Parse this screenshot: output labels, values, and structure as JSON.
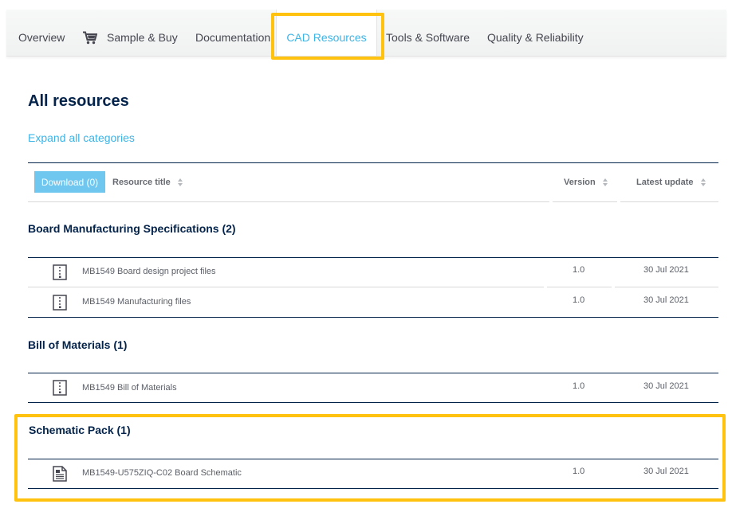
{
  "tabs": {
    "overview": "Overview",
    "sample_buy": "Sample & Buy",
    "documentation": "Documentation",
    "cad_resources": "CAD Resources",
    "tools_software": "Tools & Software",
    "quality_reliability": "Quality & Reliability",
    "active": "CAD Resources"
  },
  "page": {
    "title": "All resources",
    "expand_link": "Expand all categories"
  },
  "table_header": {
    "download_button": "Download (0)",
    "resource_title": "Resource title",
    "version": "Version",
    "latest_update": "Latest update"
  },
  "categories": [
    {
      "title": "Board Manufacturing Specifications (2)",
      "rows": [
        {
          "icon": "zip-file-icon",
          "name": "MB1549 Board design project files",
          "version": "1.0",
          "date": "30 Jul 2021"
        },
        {
          "icon": "zip-file-icon",
          "name": "MB1549 Manufacturing files",
          "version": "1.0",
          "date": "30 Jul 2021"
        }
      ]
    },
    {
      "title": "Bill of Materials (1)",
      "rows": [
        {
          "icon": "zip-file-icon",
          "name": "MB1549 Bill of Materials",
          "version": "1.0",
          "date": "30 Jul 2021"
        }
      ]
    },
    {
      "title": "Schematic Pack (1)",
      "rows": [
        {
          "icon": "document-file-icon",
          "name": "MB1549-U575ZIQ-C02 Board Schematic",
          "version": "1.0",
          "date": "30 Jul 2021"
        }
      ]
    }
  ],
  "colors": {
    "accent": "#3cb4e6",
    "download_button": "#6fc6ef",
    "heading": "#03234b",
    "highlight": "#ffc20e"
  }
}
